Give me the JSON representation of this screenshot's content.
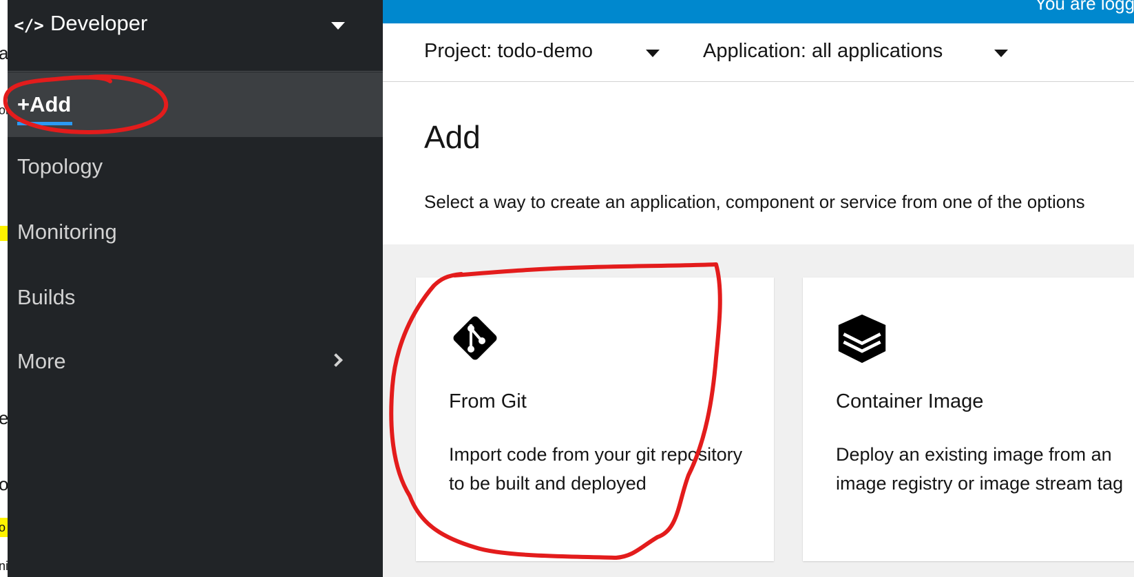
{
  "perspective_switcher": {
    "title": "Developer",
    "icon": "code-icon"
  },
  "nav": {
    "items": [
      {
        "label": "+Add",
        "active": true
      },
      {
        "label": "Topology"
      },
      {
        "label": "Monitoring"
      },
      {
        "label": "Builds"
      },
      {
        "label": "More"
      }
    ]
  },
  "masthead": {
    "logged_text": "You are logged"
  },
  "context": {
    "project": "Project: todo-demo",
    "application": "Application: all applications"
  },
  "page": {
    "title": "Add",
    "description": "Select a way to create an application, component or service from one of the options"
  },
  "cards": [
    {
      "title": "From Git",
      "description": "Import code from your git repository to be built and deployed",
      "icon": "git-icon"
    },
    {
      "title": "Container Image",
      "description": "Deploy an existing image from an image registry or image stream tag",
      "icon": "layers-icon"
    }
  ],
  "background_fragments": [
    "a",
    "ol",
    "e",
    "ol",
    "o",
    "ni"
  ],
  "colors": {
    "sidebar_bg": "#212427",
    "sidebar_active_bg": "#3c3f42",
    "active_underline": "#2b9af3",
    "masthead": "#0088ce",
    "catalog_bg": "#f0f0f0",
    "annotation_red": "#e31c1c"
  }
}
